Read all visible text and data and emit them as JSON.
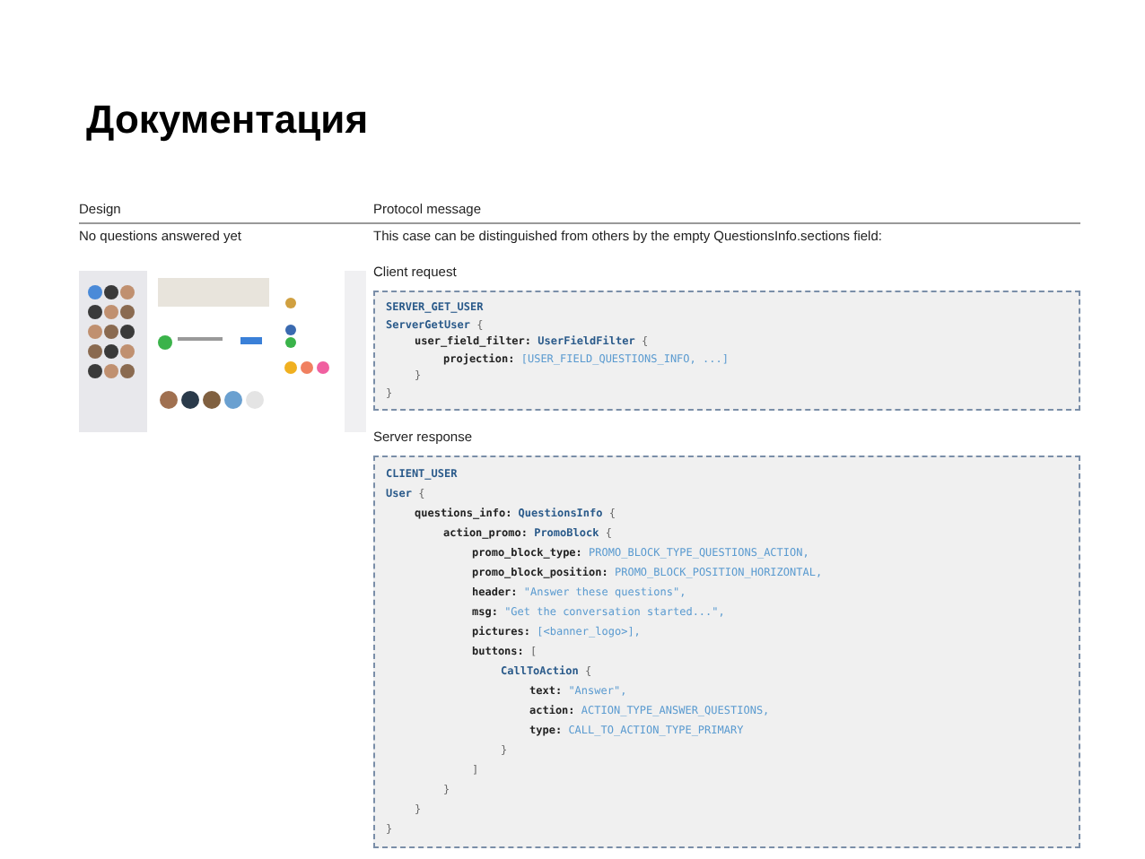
{
  "title": "Документация",
  "table": {
    "columns": [
      "Design",
      "Protocol message"
    ],
    "row": {
      "design_caption": "No questions answered yet",
      "description": "This case can be distinguished from others by the empty QuestionsInfo.sections field:",
      "sections": [
        {
          "heading": "Client request",
          "code": [
            {
              "segs": [
                {
                  "kind": "name",
                  "text": "SERVER_GET_USER"
                }
              ]
            },
            {
              "segs": [
                {
                  "kind": "name",
                  "text": "ServerGetUser"
                },
                {
                  "kind": "plain",
                  "text": " {"
                }
              ],
              "children": [
                {
                  "segs": [
                    {
                      "kind": "key",
                      "text": "user_field_filter: "
                    },
                    {
                      "kind": "name",
                      "text": "UserFieldFilter"
                    },
                    {
                      "kind": "plain",
                      "text": " {"
                    }
                  ],
                  "children": [
                    {
                      "segs": [
                        {
                          "kind": "key",
                          "text": "projection: "
                        },
                        {
                          "kind": "value",
                          "text": "[USER_FIELD_QUESTIONS_INFO, ...]"
                        }
                      ]
                    }
                  ]
                },
                {
                  "segs": [
                    {
                      "kind": "plain",
                      "text": "}"
                    }
                  ]
                }
              ]
            },
            {
              "segs": [
                {
                  "kind": "plain",
                  "text": "}"
                }
              ]
            }
          ]
        },
        {
          "heading": "Server response",
          "code": [
            {
              "segs": [
                {
                  "kind": "name",
                  "text": "CLIENT_USER"
                }
              ]
            },
            {
              "segs": [
                {
                  "kind": "name",
                  "text": "User"
                },
                {
                  "kind": "plain",
                  "text": " {"
                }
              ],
              "children": [
                {
                  "segs": [
                    {
                      "kind": "key",
                      "text": "questions_info: "
                    },
                    {
                      "kind": "name",
                      "text": "QuestionsInfo"
                    },
                    {
                      "kind": "plain",
                      "text": " {"
                    }
                  ],
                  "children": [
                    {
                      "segs": [
                        {
                          "kind": "key",
                          "text": "action_promo: "
                        },
                        {
                          "kind": "name",
                          "text": "PromoBlock"
                        },
                        {
                          "kind": "plain",
                          "text": " {"
                        }
                      ],
                      "children": [
                        {
                          "segs": [
                            {
                              "kind": "key",
                              "text": "promo_block_type: "
                            },
                            {
                              "kind": "value",
                              "text": "PROMO_BLOCK_TYPE_QUESTIONS_ACTION,"
                            }
                          ]
                        },
                        {
                          "segs": [
                            {
                              "kind": "key",
                              "text": "promo_block_position: "
                            },
                            {
                              "kind": "value",
                              "text": "PROMO_BLOCK_POSITION_HORIZONTAL,"
                            }
                          ]
                        },
                        {
                          "segs": [
                            {
                              "kind": "key",
                              "text": "header: "
                            },
                            {
                              "kind": "value",
                              "text": "\"Answer these questions\","
                            }
                          ]
                        },
                        {
                          "segs": [
                            {
                              "kind": "key",
                              "text": "msg: "
                            },
                            {
                              "kind": "value",
                              "text": "\"Get the conversation started...\","
                            }
                          ]
                        },
                        {
                          "segs": [
                            {
                              "kind": "key",
                              "text": "pictures: "
                            },
                            {
                              "kind": "value",
                              "text": "[<banner_logo>],"
                            }
                          ]
                        },
                        {
                          "segs": [
                            {
                              "kind": "key",
                              "text": "buttons: "
                            },
                            {
                              "kind": "plain",
                              "text": "["
                            }
                          ],
                          "children": [
                            {
                              "segs": [
                                {
                                  "kind": "name",
                                  "text": "CallToAction"
                                },
                                {
                                  "kind": "plain",
                                  "text": " {"
                                }
                              ],
                              "children": [
                                {
                                  "segs": [
                                    {
                                      "kind": "key",
                                      "text": "text: "
                                    },
                                    {
                                      "kind": "value",
                                      "text": "\"Answer\","
                                    }
                                  ]
                                },
                                {
                                  "segs": [
                                    {
                                      "kind": "key",
                                      "text": "action: "
                                    },
                                    {
                                      "kind": "value",
                                      "text": "ACTION_TYPE_ANSWER_QUESTIONS,"
                                    }
                                  ]
                                },
                                {
                                  "segs": [
                                    {
                                      "kind": "key",
                                      "text": "type: "
                                    },
                                    {
                                      "kind": "value",
                                      "text": "CALL_TO_ACTION_TYPE_PRIMARY"
                                    }
                                  ]
                                }
                              ]
                            },
                            {
                              "segs": [
                                {
                                  "kind": "plain",
                                  "text": "}"
                                }
                              ]
                            }
                          ]
                        },
                        {
                          "segs": [
                            {
                              "kind": "plain",
                              "text": "]"
                            }
                          ]
                        }
                      ]
                    },
                    {
                      "segs": [
                        {
                          "kind": "plain",
                          "text": "}"
                        }
                      ]
                    }
                  ]
                },
                {
                  "segs": [
                    {
                      "kind": "plain",
                      "text": "}"
                    }
                  ]
                }
              ]
            },
            {
              "segs": [
                {
                  "kind": "plain",
                  "text": "}"
                }
              ]
            }
          ]
        }
      ]
    }
  }
}
